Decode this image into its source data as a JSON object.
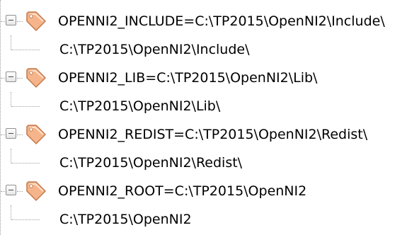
{
  "tree": {
    "nodes": [
      {
        "label": "OPENNI2_INCLUDE=C:\\TP2015\\OpenNI2\\Include\\",
        "icon": "tag-icon",
        "expanded": true,
        "child": "C:\\TP2015\\OpenNI2\\Include\\"
      },
      {
        "label": "OPENNI2_LIB=C:\\TP2015\\OpenNI2\\Lib\\",
        "icon": "tag-icon",
        "expanded": true,
        "child": "C:\\TP2015\\OpenNI2\\Lib\\"
      },
      {
        "label": "OPENNI2_REDIST=C:\\TP2015\\OpenNI2\\Redist\\",
        "icon": "tag-icon",
        "expanded": true,
        "child": "C:\\TP2015\\OpenNI2\\Redist\\"
      },
      {
        "label": "OPENNI2_ROOT=C:\\TP2015\\OpenNI2",
        "icon": "tag-icon",
        "expanded": true,
        "child": "C:\\TP2015\\OpenNI2"
      }
    ]
  },
  "colors": {
    "tag_fill": "#f6b48a",
    "tag_stroke": "#c27a4c",
    "connector": "#a0a0a0"
  }
}
